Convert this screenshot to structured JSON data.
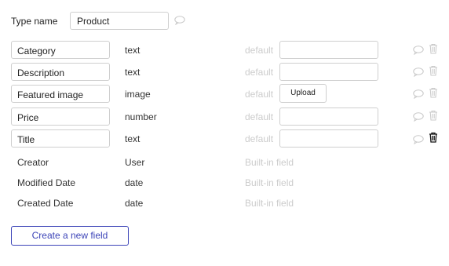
{
  "header": {
    "type_name_label": "Type name",
    "type_name_value": "Product"
  },
  "fields": [
    {
      "name": "Category",
      "type": "text",
      "default_label": "default",
      "default_kind": "input",
      "default_value": ""
    },
    {
      "name": "Description",
      "type": "text",
      "default_label": "default",
      "default_kind": "input",
      "default_value": ""
    },
    {
      "name": "Featured image",
      "type": "image",
      "default_label": "default",
      "default_kind": "upload",
      "upload_label": "Upload"
    },
    {
      "name": "Price",
      "type": "number",
      "default_label": "default",
      "default_kind": "input",
      "default_value": ""
    },
    {
      "name": "Title",
      "type": "text",
      "default_label": "default",
      "default_kind": "input",
      "default_value": "",
      "trash_active": true
    }
  ],
  "builtin_fields": [
    {
      "name": "Creator",
      "type": "User",
      "note": "Built-in field"
    },
    {
      "name": "Modified Date",
      "type": "date",
      "note": "Built-in field"
    },
    {
      "name": "Created Date",
      "type": "date",
      "note": "Built-in field"
    }
  ],
  "actions": {
    "create_field_label": "Create a new field"
  },
  "icons": {
    "comment": "comment-icon",
    "trash": "trash-icon"
  },
  "colors": {
    "accent": "#3c44b8",
    "muted_text": "#cccccc",
    "icon_muted": "#c8c8c8",
    "icon_active": "#111111",
    "border": "#cfcfcf"
  }
}
